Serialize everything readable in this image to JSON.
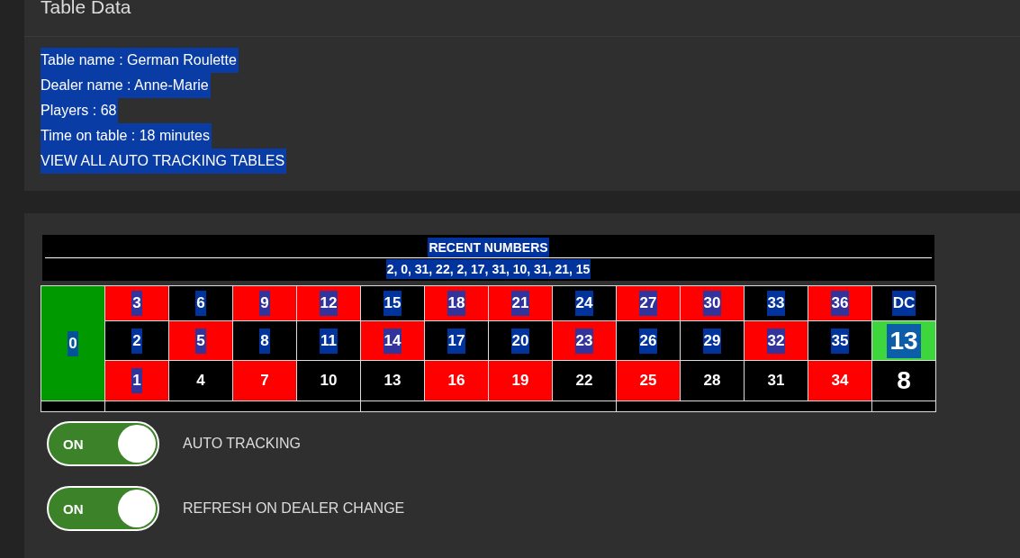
{
  "panel": {
    "title": "Table Data"
  },
  "table_info": [
    {
      "text": "Table name : German Roulette",
      "highlighted": true
    },
    {
      "text": "Dealer name : Anne-Marie",
      "highlighted": true
    },
    {
      "text": "Players : 68",
      "highlighted": true
    },
    {
      "text": "Time on table : 18 minutes",
      "highlighted": true
    }
  ],
  "view_all_link": {
    "label": "VIEW ALL AUTO TRACKING TABLES",
    "highlighted": true
  },
  "recent_numbers": {
    "heading": {
      "text": "RECENT NUMBERS",
      "highlighted": true
    },
    "values": {
      "text": "2, 0, 31, 22, 2, 17, 31, 10, 31, 21, 15",
      "highlighted": true
    }
  },
  "board": {
    "zero": {
      "label": "0",
      "color": "#009900",
      "highlighted": true
    },
    "rows": [
      [
        {
          "label": "3",
          "color": "#ff0000",
          "highlighted": true
        },
        {
          "label": "6",
          "color": "#000000",
          "highlighted": true
        },
        {
          "label": "9",
          "color": "#ff0000",
          "highlighted": true
        },
        {
          "label": "12",
          "color": "#ff0000",
          "highlighted": true
        },
        {
          "label": "15",
          "color": "#000000",
          "highlighted": true
        },
        {
          "label": "18",
          "color": "#ff0000",
          "highlighted": true
        },
        {
          "label": "21",
          "color": "#ff0000",
          "highlighted": true
        },
        {
          "label": "24",
          "color": "#000000",
          "highlighted": true
        },
        {
          "label": "27",
          "color": "#ff0000",
          "highlighted": true
        },
        {
          "label": "30",
          "color": "#ff0000",
          "highlighted": true
        },
        {
          "label": "33",
          "color": "#000000",
          "highlighted": true
        },
        {
          "label": "36",
          "color": "#ff0000",
          "highlighted": true
        }
      ],
      [
        {
          "label": "2",
          "color": "#000000",
          "highlighted": true
        },
        {
          "label": "5",
          "color": "#ff0000",
          "highlighted": true
        },
        {
          "label": "8",
          "color": "#000000",
          "highlighted": true
        },
        {
          "label": "11",
          "color": "#000000",
          "highlighted": true
        },
        {
          "label": "14",
          "color": "#ff0000",
          "highlighted": true
        },
        {
          "label": "17",
          "color": "#000000",
          "highlighted": true
        },
        {
          "label": "20",
          "color": "#000000",
          "highlighted": true
        },
        {
          "label": "23",
          "color": "#ff0000",
          "highlighted": true
        },
        {
          "label": "26",
          "color": "#000000",
          "highlighted": true
        },
        {
          "label": "29",
          "color": "#000000",
          "highlighted": true
        },
        {
          "label": "32",
          "color": "#ff0000",
          "highlighted": true
        },
        {
          "label": "35",
          "color": "#000000",
          "highlighted": true
        }
      ],
      [
        {
          "label": "1",
          "color": "#ff0000",
          "highlighted": true
        },
        {
          "label": "4",
          "color": "#000000",
          "highlighted": false
        },
        {
          "label": "7",
          "color": "#ff0000",
          "highlighted": false
        },
        {
          "label": "10",
          "color": "#000000",
          "highlighted": false
        },
        {
          "label": "13",
          "color": "#000000",
          "highlighted": false
        },
        {
          "label": "16",
          "color": "#ff0000",
          "highlighted": false
        },
        {
          "label": "19",
          "color": "#ff0000",
          "highlighted": false
        },
        {
          "label": "22",
          "color": "#000000",
          "highlighted": false
        },
        {
          "label": "25",
          "color": "#ff0000",
          "highlighted": false
        },
        {
          "label": "28",
          "color": "#000000",
          "highlighted": false
        },
        {
          "label": "31",
          "color": "#000000",
          "highlighted": false
        },
        {
          "label": "34",
          "color": "#ff0000",
          "highlighted": false
        }
      ]
    ],
    "side_column": [
      {
        "kind": "heading",
        "label": "DC",
        "color": "#000000",
        "highlighted": true
      },
      {
        "kind": "value",
        "label": "13",
        "color": "#3dd63d",
        "highlighted": true
      },
      {
        "kind": "value",
        "label": "8",
        "color": "#000000",
        "highlighted": false
      }
    ]
  },
  "toggles": [
    {
      "state_label": "ON",
      "on": true,
      "label": "AUTO TRACKING"
    },
    {
      "state_label": "ON",
      "on": true,
      "label": "REFRESH ON DEALER CHANGE"
    }
  ]
}
